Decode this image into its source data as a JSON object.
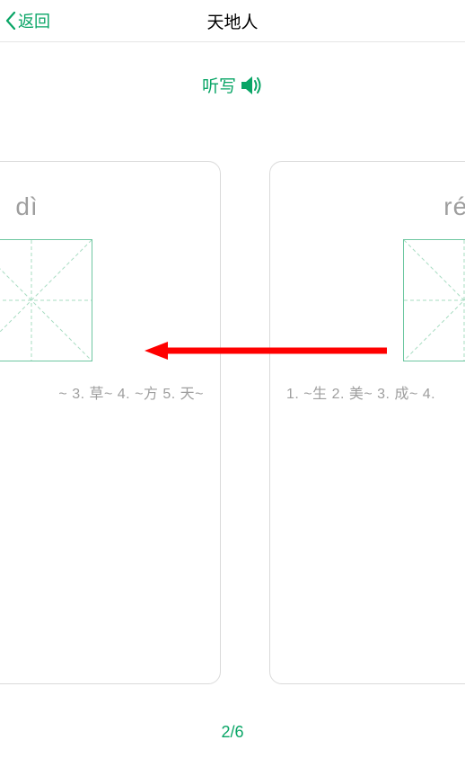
{
  "header": {
    "back_label": "返回",
    "title": "天地人"
  },
  "dictation": {
    "label": "听写"
  },
  "cards": {
    "left": {
      "pinyin": "dì",
      "examples": "~  3. 草~  4. ~方  5. 天~"
    },
    "right": {
      "pinyin": "rén",
      "examples": "1. ~生  2. 美~  3. 成~  4."
    }
  },
  "page_indicator": "2/6",
  "colors": {
    "accent": "#09a566",
    "grid": "#6ec7a1",
    "muted": "#9e9e9e"
  }
}
